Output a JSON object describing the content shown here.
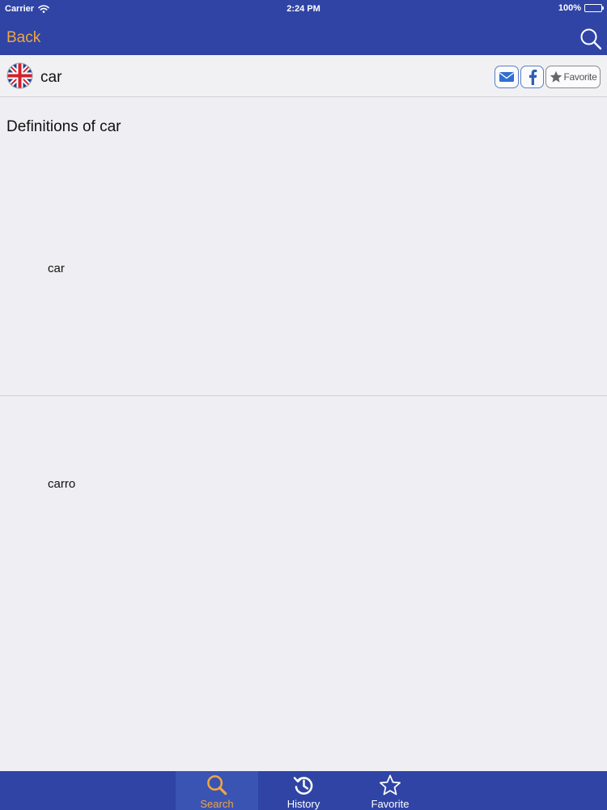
{
  "status_bar": {
    "carrier": "Carrier",
    "time": "2:24 PM",
    "battery": "100%"
  },
  "nav": {
    "back_label": "Back"
  },
  "word": {
    "title": "car",
    "favorite_label": "Favorite"
  },
  "definitions": {
    "heading": "Definitions of car",
    "entries": [
      "car",
      "carro"
    ]
  },
  "tabs": [
    {
      "label": "Search",
      "icon": "search-icon",
      "active": true
    },
    {
      "label": "History",
      "icon": "history-icon",
      "active": false
    },
    {
      "label": "Favorite",
      "icon": "star-icon",
      "active": false
    }
  ],
  "colors": {
    "bar_blue": "#2f44a5",
    "accent_orange": "#f0a640",
    "background": "#eeeef3"
  }
}
